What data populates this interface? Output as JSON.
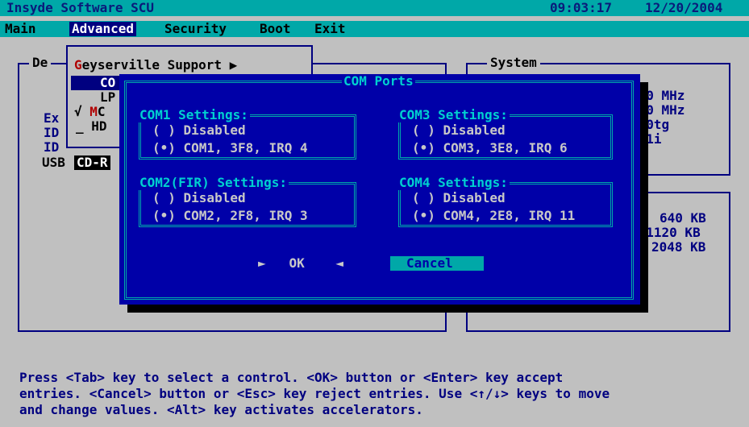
{
  "titlebar": {
    "title": "Insyde Software SCU",
    "time": "09:03:17",
    "date": "12/20/2004"
  },
  "menu": {
    "items": [
      "Main",
      "Advanced",
      "Security",
      "Boot",
      "Exit"
    ],
    "active": "Advanced"
  },
  "bg": {
    "left_label": "De",
    "left_rows": [
      "Ex",
      "ID",
      "ID"
    ],
    "usb_label": "USB",
    "usb_value": "CD-R",
    "system_label": "System",
    "system_values": [
      "400 MHz",
      "400 MHz",
      ".00tg",
      ".01i"
    ],
    "memory_values": [
      "640 KB",
      "261120 KB",
      "2048 KB"
    ]
  },
  "popup": {
    "items": [
      {
        "mark": "",
        "hot": "G",
        "rest": "eyserville Support",
        "arrow": "▶"
      },
      {
        "mark": "",
        "hot": "",
        "rest": "CO"
      },
      {
        "mark": "",
        "hot": "",
        "rest": "LP"
      },
      {
        "mark": "√",
        "hot": "M",
        "rest": "C"
      },
      {
        "mark": "_",
        "hot": "",
        "rest": "HD"
      }
    ]
  },
  "dialog": {
    "title": "COM Ports",
    "groups": [
      {
        "title": "COM1 Settings:",
        "opt1": "( ) Disabled",
        "opt2": "(•) COM1, 3F8, IRQ 4"
      },
      {
        "title": "COM3 Settings:",
        "opt1": "( ) Disabled",
        "opt2": "(•) COM3, 3E8, IRQ 6"
      },
      {
        "title": "COM2(FIR) Settings:",
        "opt1": "( ) Disabled",
        "opt2": "(•) COM2, 2F8, IRQ 3"
      },
      {
        "title": "COM4 Settings:",
        "opt1": "( ) Disabled",
        "opt2": "(•) COM4, 2E8, IRQ 11"
      }
    ],
    "ok_label": "OK",
    "cancel_label": "Cancel"
  },
  "status": {
    "lines": [
      "Press <Tab> key to select a control. <OK> button or <Enter> key accept",
      "entries. <Cancel> button or <Esc> key reject entries. Use <↑/↓> keys to move",
      "and change values. <Alt> key activates accelerators."
    ]
  },
  "colors": {
    "cyan": "#00a8a8",
    "dialog_blue": "#0000a8",
    "navy": "#000080",
    "gray": "#c0c0c0"
  }
}
